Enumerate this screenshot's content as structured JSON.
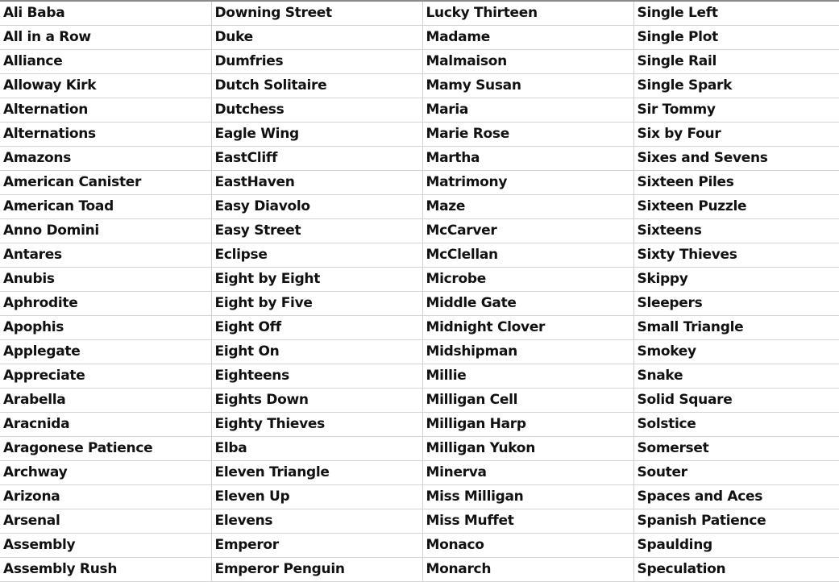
{
  "columns": [
    [
      "Ali Baba",
      "All in a Row",
      "Alliance",
      "Alloway Kirk",
      "Alternation",
      "Alternations",
      "Amazons",
      "American Canister",
      "American Toad",
      "Anno Domini",
      "Antares",
      "Anubis",
      "Aphrodite",
      "Apophis",
      "Applegate",
      "Appreciate",
      "Arabella",
      "Aracnida",
      "Aragonese Patience",
      "Archway",
      "Arizona",
      "Arsenal",
      "Assembly",
      "Assembly Rush"
    ],
    [
      "Downing Street",
      "Duke",
      "Dumfries",
      "Dutch Solitaire",
      "Dutchess",
      "Eagle Wing",
      "EastCliff",
      "EastHaven",
      "Easy Diavolo",
      "Easy Street",
      "Eclipse",
      "Eight by Eight",
      "Eight by Five",
      "Eight Off",
      "Eight On",
      "Eighteens",
      "Eights Down",
      "Eighty Thieves",
      "Elba",
      "Eleven Triangle",
      "Eleven Up",
      "Elevens",
      "Emperor",
      "Emperor Penguin"
    ],
    [
      "Lucky Thirteen",
      "Madame",
      "Malmaison",
      "Mamy Susan",
      "Maria",
      "Marie Rose",
      "Martha",
      "Matrimony",
      "Maze",
      "McCarver",
      "McClellan",
      "Microbe",
      "Middle Gate",
      "Midnight Clover",
      "Midshipman",
      "Millie",
      "Milligan Cell",
      "Milligan Harp",
      "Milligan Yukon",
      "Minerva",
      "Miss Milligan",
      "Miss Muffet",
      "Monaco",
      "Monarch"
    ],
    [
      "Single Left",
      "Single Plot",
      "Single Rail",
      "Single Spark",
      "Sir Tommy",
      "Six by Four",
      "Sixes and Sevens",
      "Sixteen Piles",
      "Sixteen Puzzle",
      "Sixteens",
      "Sixty Thieves",
      "Skippy",
      "Sleepers",
      "Small Triangle",
      "Smokey",
      "Snake",
      "Solid Square",
      "Solstice",
      "Somerset",
      "Souter",
      "Spaces and Aces",
      "Spanish Patience",
      "Spaulding",
      "Speculation"
    ]
  ]
}
